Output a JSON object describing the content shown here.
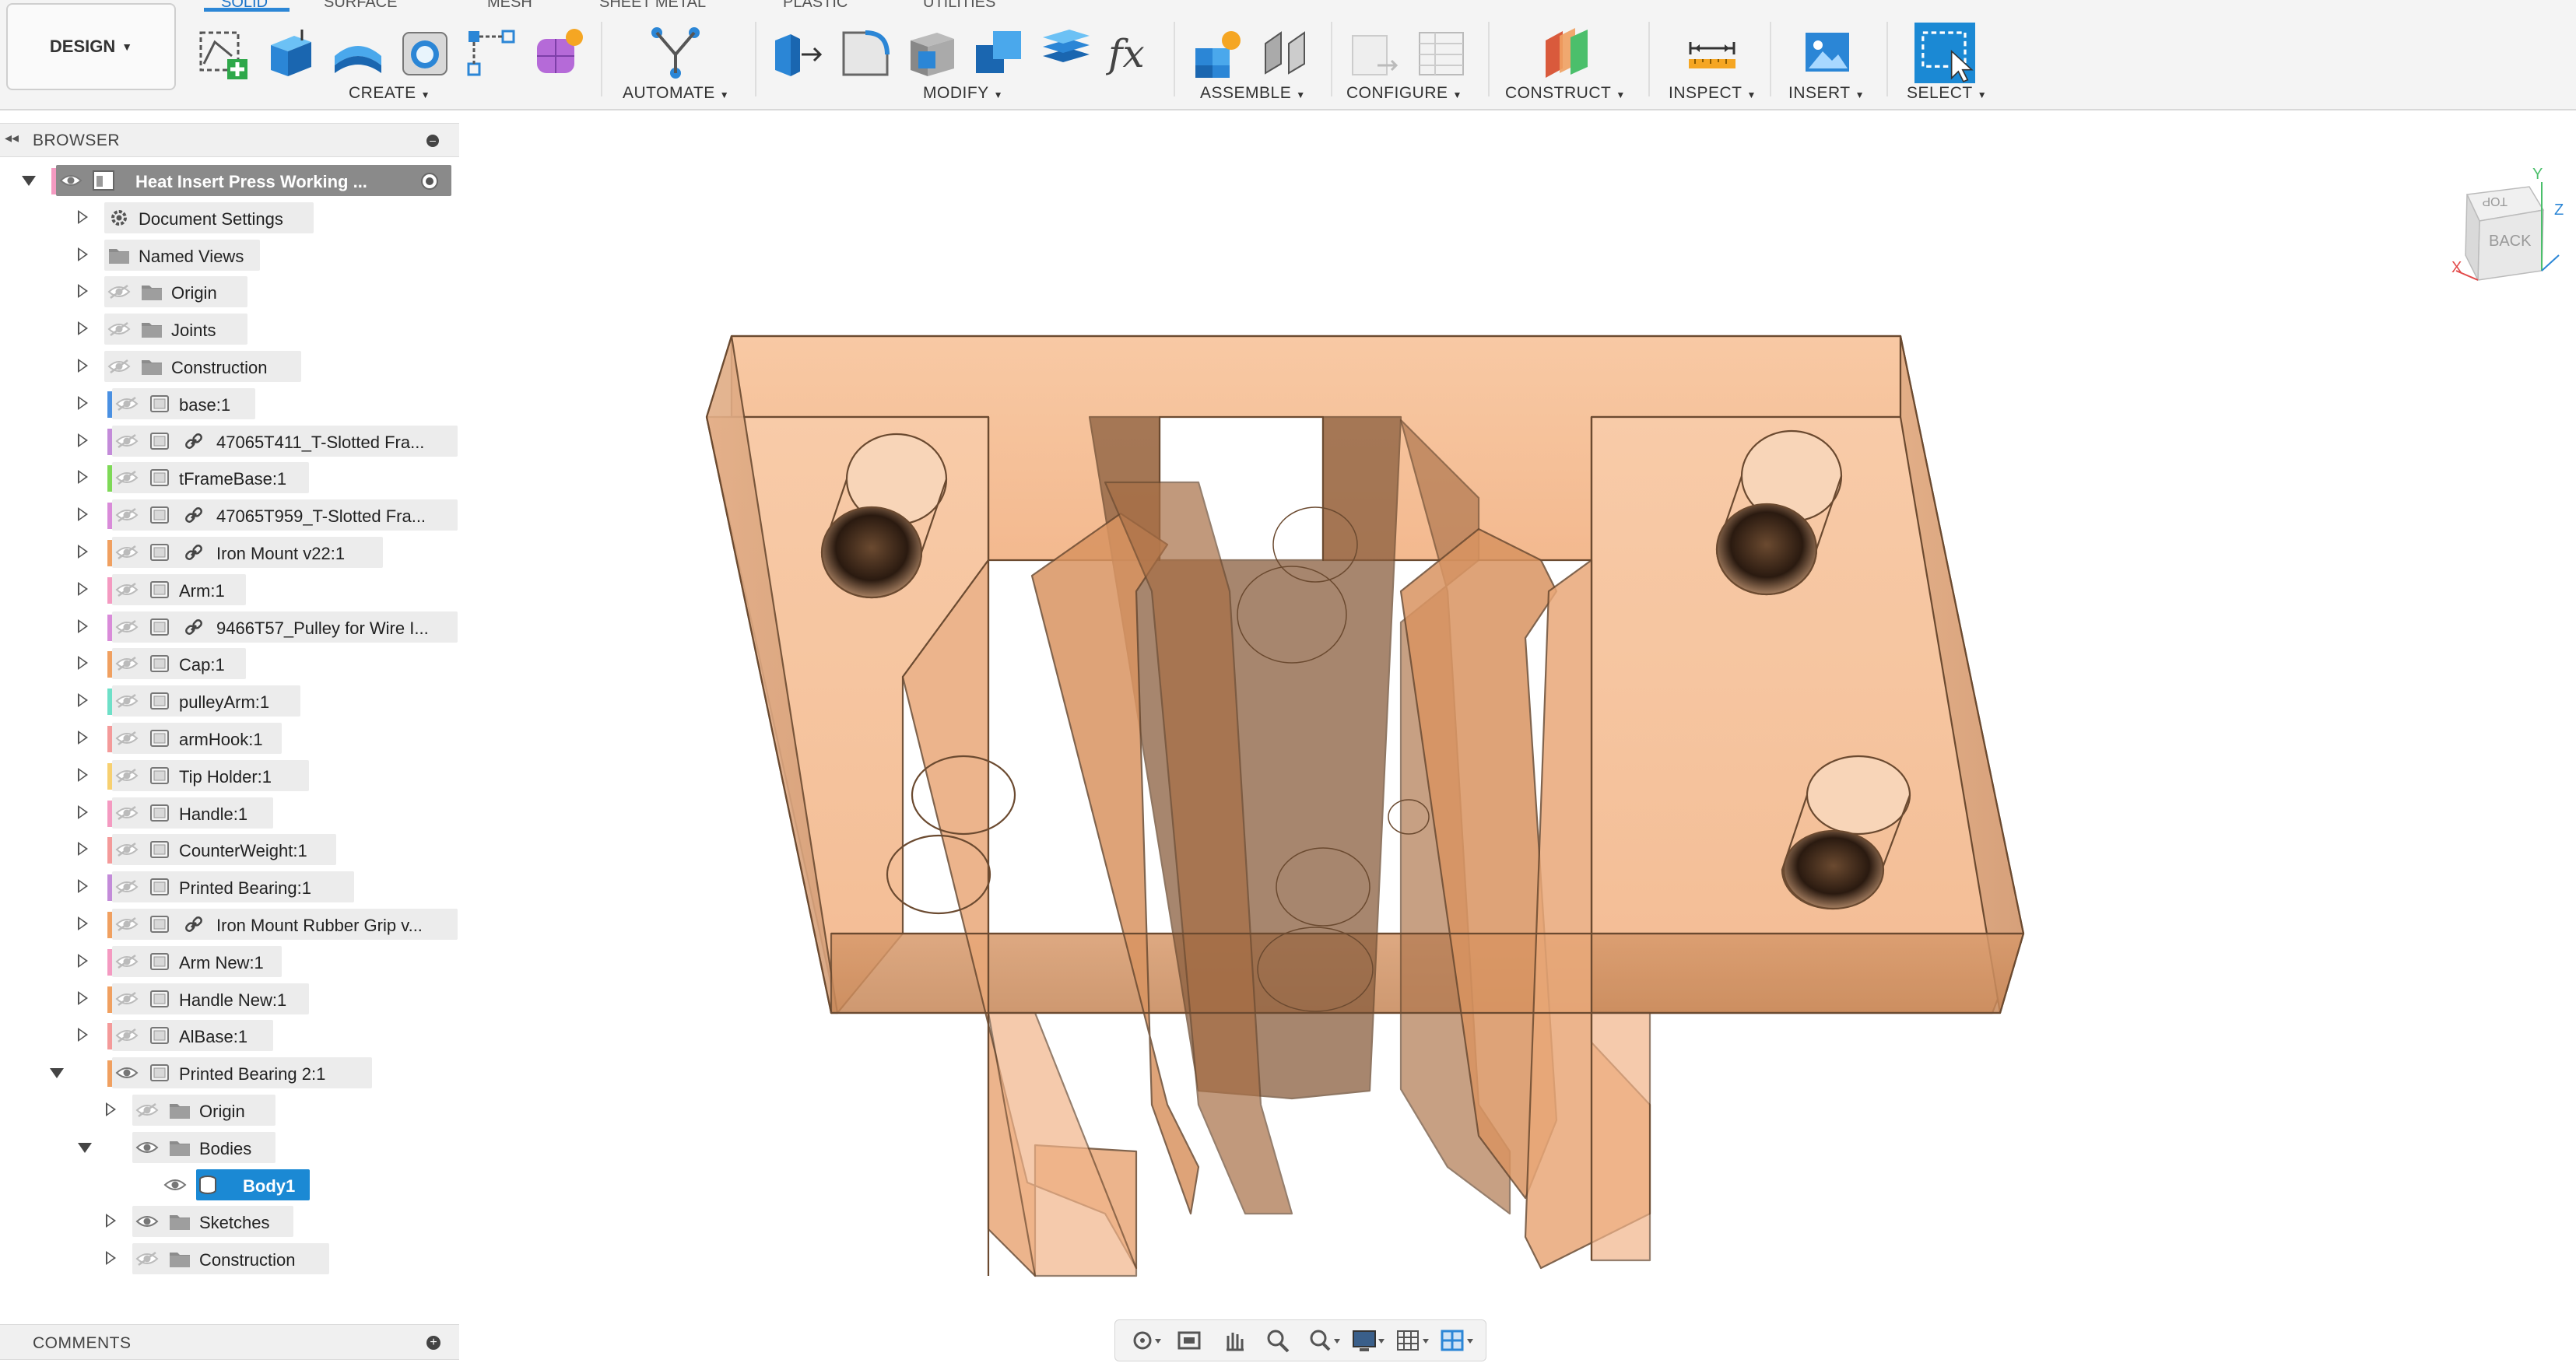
{
  "workspace": {
    "label": "DESIGN"
  },
  "tabs": [
    "SOLID",
    "SURFACE",
    "MESH",
    "SHEET METAL",
    "PLASTIC",
    "UTILITIES"
  ],
  "toolbar_groups": [
    {
      "label": "CREATE",
      "icons": [
        "new-sketch-icon",
        "extrude-icon",
        "revolve-icon",
        "hole-icon",
        "pattern-icon",
        "form-icon"
      ]
    },
    {
      "label": "AUTOMATE",
      "icons": [
        "automate-icon"
      ]
    },
    {
      "label": "MODIFY",
      "icons": [
        "press-pull-icon",
        "fillet-icon",
        "shell-icon",
        "combine-icon",
        "offset-face-icon",
        "parameters-icon"
      ]
    },
    {
      "label": "ASSEMBLE",
      "icons": [
        "new-component-icon",
        "joint-icon"
      ]
    },
    {
      "label": "CONFIGURE",
      "icons": [
        "configure-icon",
        "table-icon"
      ]
    },
    {
      "label": "CONSTRUCT",
      "icons": [
        "plane-icon"
      ]
    },
    {
      "label": "INSPECT",
      "icons": [
        "measure-icon"
      ]
    },
    {
      "label": "INSERT",
      "icons": [
        "image-icon"
      ]
    },
    {
      "label": "SELECT",
      "icons": [
        "select-icon"
      ]
    }
  ],
  "colors": {
    "accent": "#1b89d4",
    "part_fill": "#f4b98d",
    "part_edge": "#6b4a30"
  },
  "browser": {
    "title": "BROWSER",
    "items": [
      {
        "label": "Heat Insert Press Working ...",
        "level": 0,
        "expanded": true,
        "eye": "visible",
        "icon": "document-icon",
        "color": "#f49ac1",
        "root": true
      },
      {
        "label": "Document Settings",
        "level": 1,
        "icon": "gear-icon"
      },
      {
        "label": "Named Views",
        "level": 1,
        "icon": "folder-icon"
      },
      {
        "label": "Origin",
        "level": 1,
        "eye": "hidden",
        "icon": "folder-icon"
      },
      {
        "label": "Joints",
        "level": 1,
        "eye": "hidden",
        "icon": "folder-icon"
      },
      {
        "label": "Construction",
        "level": 1,
        "eye": "hidden",
        "icon": "folder-icon"
      },
      {
        "label": "base:1",
        "level": 1,
        "eye": "hidden",
        "icon": "component-icon",
        "color": "#4a90e2"
      },
      {
        "label": "47065T411_T-Slotted Fra...",
        "level": 1,
        "eye": "hidden",
        "icon": "component-icon",
        "link": true,
        "color": "#c38bd9"
      },
      {
        "label": "tFrameBase:1",
        "level": 1,
        "eye": "hidden",
        "icon": "component-icon",
        "color": "#7ed957"
      },
      {
        "label": "47065T959_T-Slotted Fra...",
        "level": 1,
        "eye": "hidden",
        "icon": "component-icon",
        "link": true,
        "color": "#d98bd9"
      },
      {
        "label": "Iron Mount v22:1",
        "level": 1,
        "eye": "hidden",
        "icon": "component-icon",
        "link": true,
        "color": "#f0a060"
      },
      {
        "label": "Arm:1",
        "level": 1,
        "eye": "hidden",
        "icon": "component-icon",
        "color": "#f49ac1"
      },
      {
        "label": "9466T57_Pulley for Wire I...",
        "level": 1,
        "eye": "hidden",
        "icon": "component-icon",
        "link": true,
        "color": "#d98bd9"
      },
      {
        "label": "Cap:1",
        "level": 1,
        "eye": "hidden",
        "icon": "component-icon",
        "color": "#f0a060"
      },
      {
        "label": "pulleyArm:1",
        "level": 1,
        "eye": "hidden",
        "icon": "component-icon",
        "color": "#6ee0c8"
      },
      {
        "label": "armHook:1",
        "level": 1,
        "eye": "hidden",
        "icon": "component-icon",
        "color": "#f49a9a"
      },
      {
        "label": "Tip Holder:1",
        "level": 1,
        "eye": "hidden",
        "icon": "component-icon",
        "color": "#f7d070"
      },
      {
        "label": "Handle:1",
        "level": 1,
        "eye": "hidden",
        "icon": "component-icon",
        "color": "#f49ac1"
      },
      {
        "label": "CounterWeight:1",
        "level": 1,
        "eye": "hidden",
        "icon": "component-icon",
        "color": "#f49a9a"
      },
      {
        "label": "Printed Bearing:1",
        "level": 1,
        "eye": "hidden",
        "icon": "component-icon",
        "color": "#c38bd9"
      },
      {
        "label": "Iron Mount Rubber Grip v...",
        "level": 1,
        "eye": "hidden",
        "icon": "component-icon",
        "link": true,
        "color": "#f0a060"
      },
      {
        "label": "Arm New:1",
        "level": 1,
        "eye": "hidden",
        "icon": "component-icon",
        "color": "#f49ac1"
      },
      {
        "label": "Handle New:1",
        "level": 1,
        "eye": "hidden",
        "icon": "component-icon",
        "color": "#f0a060"
      },
      {
        "label": "AlBase:1",
        "level": 1,
        "eye": "hidden",
        "icon": "component-icon",
        "color": "#f49a9a"
      },
      {
        "label": "Printed Bearing 2:1",
        "level": 1,
        "expanded": true,
        "eye": "visible",
        "icon": "component-icon",
        "color": "#f0a060"
      },
      {
        "label": "Origin",
        "level": 2,
        "eye": "hidden",
        "icon": "folder-icon"
      },
      {
        "label": "Bodies",
        "level": 2,
        "expanded": true,
        "eye": "visible",
        "icon": "folder-icon"
      },
      {
        "label": "Body1",
        "level": 3,
        "eye": "visible",
        "icon": "body-icon",
        "selected": true,
        "leaf": true
      },
      {
        "label": "Sketches",
        "level": 2,
        "eye": "visible",
        "icon": "folder-icon"
      },
      {
        "label": "Construction",
        "level": 2,
        "eye": "hidden",
        "icon": "folder-icon"
      }
    ]
  },
  "comments": {
    "title": "COMMENTS"
  },
  "viewcube": {
    "top": "TOP",
    "back": "BACK",
    "axis_x": "X",
    "axis_y": "Y",
    "axis_z": "Z"
  }
}
